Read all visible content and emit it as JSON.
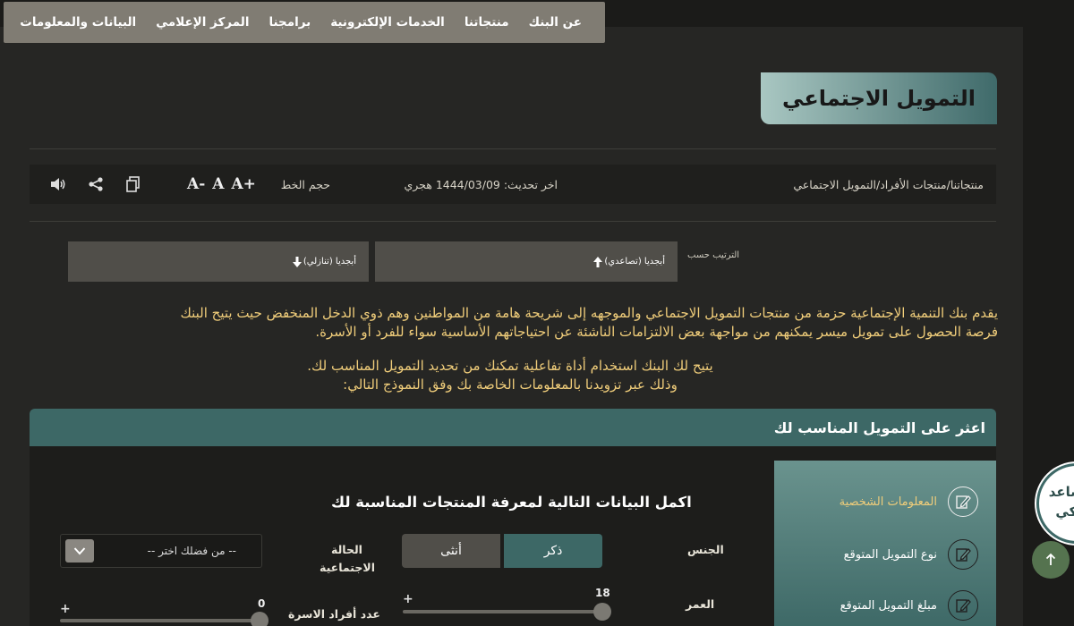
{
  "nav": {
    "items": [
      {
        "label": "عن البنك"
      },
      {
        "label": "منتجاتنا"
      },
      {
        "label": "الخدمات الإلكترونية"
      },
      {
        "label": "برامجنا"
      },
      {
        "label": "المركز الإعلامي"
      },
      {
        "label": "البيانات والمعلومات"
      }
    ]
  },
  "page": {
    "title": "التمويل الاجتماعي"
  },
  "toolbar": {
    "breadcrumb": "منتجاتنا/منتجات الأفراد/التمويل الاجتماعي",
    "last_update": "اخر تحديث: 1444/03/09 هجري",
    "font_size_label": "حجم الخط",
    "font_increase": "+A",
    "font_normal": "A",
    "font_decrease": "-A",
    "icons": [
      "speaker-icon",
      "share-icon",
      "copy-icon"
    ]
  },
  "sort": {
    "label": "الترتيب حسب",
    "ascending": "أبجديا (تصاعدي)",
    "descending": "أبجديا (تنازلي)"
  },
  "intro": {
    "paragraph_line1": "يقدم بنك التنمية الإجتماعية حزمة من منتجات التمويل الاجتماعي والموجهه إلى شريحة هامة من المواطنين وهم ذوي الدخل المنخفض حيث يتيح البنك",
    "paragraph_line2": "فرصة الحصول على تمويل ميسر يمكنهم من مواجهة بعض الالتزامات الناشئة عن احتياجاتهم الأساسية سواء للفرد أو الأسرة.",
    "tool_line1": "يتيح لك البنك استخدام أداة تفاعلية تمكنك من تحديد التمويل المناسب لك.",
    "tool_line2": "وذلك عبر تزويدنا بالمعلومات الخاصة بك وفق النموذج التالي:"
  },
  "finder": {
    "header": "اعثر على التمويل المناسب لك",
    "steps": [
      {
        "label": "المعلومات الشخصية",
        "active": true
      },
      {
        "label": "نوع التمويل المتوقع",
        "active": false
      },
      {
        "label": "مبلغ التمويل المتوقع",
        "active": false
      }
    ],
    "form_title": "اكمل البيانات التالية لمعرفة المنتجات المناسبة لك",
    "gender_label": "الجنس",
    "gender_male": "ذكر",
    "gender_female": "أنثى",
    "gender_selected": "ذكر",
    "marital_label_line1": "الحالة",
    "marital_label_line2": "الاجتماعية",
    "marital_placeholder": "-- من فضلك اختر --",
    "age_label": "العمر",
    "age_value": "18",
    "family_label": "عدد أفراد الاسرة",
    "family_value": "0"
  },
  "assistant": {
    "line1": "ساعد",
    "line2": "ذكي"
  },
  "colors": {
    "accent_teal": "#3d6866",
    "highlight_gold": "#f0cd7a",
    "nav_bg": "#807c73"
  }
}
